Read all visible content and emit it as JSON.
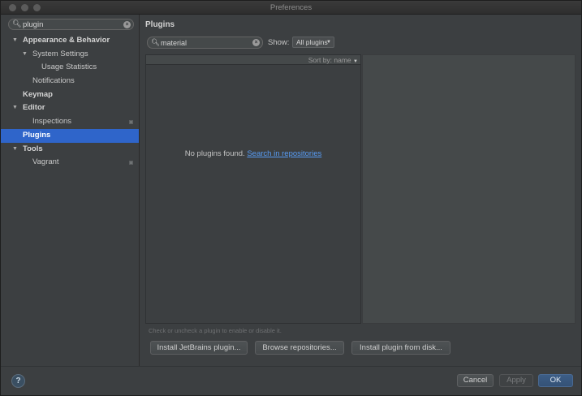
{
  "window": {
    "title": "Preferences"
  },
  "sidebar": {
    "search_value": "plugin",
    "items": [
      {
        "label": "Appearance & Behavior",
        "level": 0,
        "expanded": true,
        "bold": true
      },
      {
        "label": "System Settings",
        "level": 1,
        "expanded": true,
        "bold": false
      },
      {
        "label": "Usage Statistics",
        "level": 2,
        "bold": false
      },
      {
        "label": "Notifications",
        "level": 1,
        "bold": false
      },
      {
        "label": "Keymap",
        "level": 0,
        "bold": true
      },
      {
        "label": "Editor",
        "level": 0,
        "expanded": true,
        "bold": true
      },
      {
        "label": "Inspections",
        "level": 1,
        "bold": false,
        "project_icon": true
      },
      {
        "label": "Plugins",
        "level": 0,
        "bold": true,
        "selected": true
      },
      {
        "label": "Tools",
        "level": 0,
        "expanded": true,
        "bold": true
      },
      {
        "label": "Vagrant",
        "level": 1,
        "bold": false,
        "project_icon": true
      }
    ]
  },
  "main": {
    "title": "Plugins",
    "search_value": "material",
    "show_label": "Show:",
    "show_value": "All plugins",
    "sort_label": "Sort by: name",
    "empty_text": "No plugins found.",
    "search_link": "Search in repositories",
    "hint": "Check or uncheck a plugin to enable or disable it.",
    "buttons": {
      "install_jetbrains": "Install JetBrains plugin...",
      "browse": "Browse repositories...",
      "install_disk": "Install plugin from disk..."
    }
  },
  "footer": {
    "help": "?",
    "cancel": "Cancel",
    "apply": "Apply",
    "ok": "OK"
  },
  "colors": {
    "selection": "#2f65ca",
    "link": "#589df6",
    "ok_button": "#3c5d86"
  }
}
